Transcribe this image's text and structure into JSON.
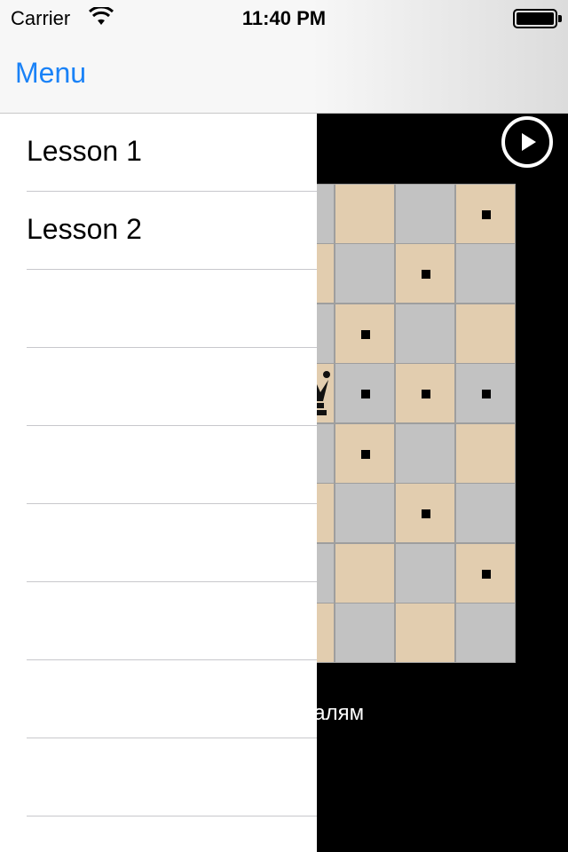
{
  "status_bar": {
    "carrier": "Carrier",
    "time": "11:40 PM",
    "wifi_icon": "wifi-icon",
    "battery_icon": "battery-icon"
  },
  "nav_bar": {
    "menu_label": "Menu"
  },
  "drawer": {
    "items": [
      {
        "label": "Lesson 1"
      },
      {
        "label": "Lesson 2"
      },
      {
        "label": ""
      },
      {
        "label": ""
      },
      {
        "label": ""
      },
      {
        "label": ""
      },
      {
        "label": ""
      },
      {
        "label": ""
      },
      {
        "label": ""
      }
    ]
  },
  "lesson": {
    "play_icon": "play-icon",
    "piece_icon": "queen-icon",
    "caption": "лям, горизонталям",
    "colors": {
      "light_square": "#e2cdaf",
      "dark_square": "#c2c2c2",
      "move_marker": "#000000",
      "accent": "#1a82f7"
    }
  }
}
